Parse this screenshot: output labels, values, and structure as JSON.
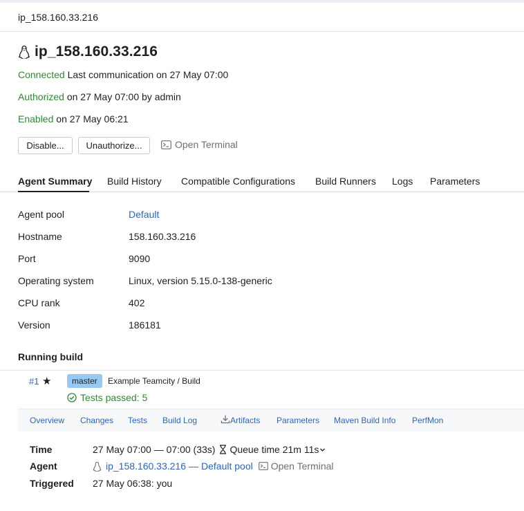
{
  "breadcrumb": "ip_158.160.33.216",
  "agent": {
    "name": "ip_158.160.33.216",
    "status": {
      "connected": "Connected",
      "connected_text": "Last communication on 27 May 07:00",
      "authorized": "Authorized",
      "authorized_text": "on 27 May 07:00 by admin",
      "enabled": "Enabled",
      "enabled_text": "on 27 May 06:21"
    },
    "actions": {
      "disable": "Disable...",
      "unauthorize": "Unauthorize...",
      "open_terminal": "Open Terminal"
    }
  },
  "tabs": [
    {
      "label": "Agent Summary",
      "active": true
    },
    {
      "label": "Build History"
    },
    {
      "label": "Compatible Configurations"
    },
    {
      "label": "Build Runners"
    },
    {
      "label": "Logs"
    },
    {
      "label": "Parameters"
    }
  ],
  "summary": [
    {
      "label": "Agent pool",
      "value": "Default",
      "link": true
    },
    {
      "label": "Hostname",
      "value": "158.160.33.216"
    },
    {
      "label": "Port",
      "value": "9090"
    },
    {
      "label": "Operating system",
      "value": "Linux, version 5.15.0-138-generic"
    },
    {
      "label": "CPU rank",
      "value": "402"
    },
    {
      "label": "Version",
      "value": "186181"
    }
  ],
  "running_build": {
    "section_title": "Running build",
    "number": "#1",
    "branch": "master",
    "configuration": "Example Teamcity / Build",
    "tests": "Tests passed: 5",
    "tabs": [
      "Overview",
      "Changes",
      "Tests",
      "Build Log",
      "Artifacts",
      "Parameters",
      "Maven Build Info",
      "PerfMon"
    ],
    "details": {
      "time_label": "Time",
      "time_value": "27 May 07:00 — 07:00 (33s)",
      "queue_time": "Queue time 21m 11s",
      "agent_label": "Agent",
      "agent_link": "ip_158.160.33.216",
      "agent_sep": "—",
      "agent_pool_link": "Default pool",
      "open_terminal": "Open Terminal",
      "triggered_label": "Triggered",
      "triggered_value": "27 May 06:38: you"
    }
  },
  "colors": {
    "link": "#2e65b8",
    "success": "#2f8a36",
    "branch_badge": "#97c9f5"
  }
}
